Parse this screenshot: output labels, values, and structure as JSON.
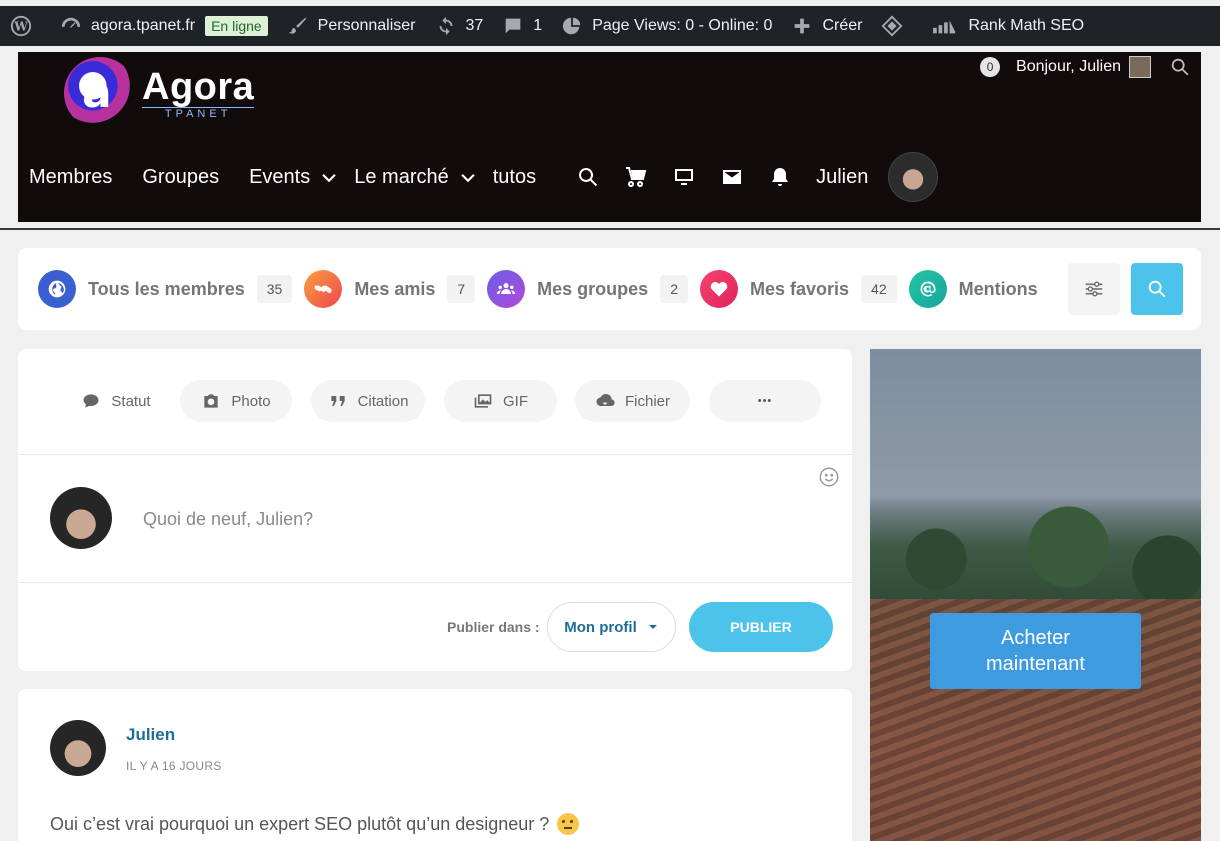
{
  "admin_bar": {
    "site_name": "agora.tpanet.fr",
    "status_badge": "En ligne",
    "customize": "Personnaliser",
    "updates_count": "37",
    "comments_count": "1",
    "page_views": "Page Views: 0 - Online: 0",
    "create": "Créer",
    "rank_math": "Rank Math SEO"
  },
  "header": {
    "logo_title": "Agora",
    "logo_subtitle": "TPANET",
    "notifications_count": "0",
    "greeting": "Bonjour, Julien",
    "nav": [
      "Membres",
      "Groupes",
      "Events",
      "Le marché",
      "tutos"
    ],
    "user_name": "Julien"
  },
  "filters": [
    {
      "label": "Tous les membres",
      "count": "35",
      "color": "#3a5fd0",
      "icon": "globe-icon"
    },
    {
      "label": "Mes amis",
      "count": "7",
      "color": "#f2674a",
      "icon": "handshake-icon"
    },
    {
      "label": "Mes groupes",
      "count": "2",
      "color": "#8e4ce0",
      "icon": "users-icon"
    },
    {
      "label": "Mes favoris",
      "count": "42",
      "color": "#ef3d6a",
      "icon": "heart-icon"
    },
    {
      "label": "Mentions",
      "count": "",
      "color": "#1fb8a0",
      "icon": "at-icon"
    }
  ],
  "composer": {
    "tabs": [
      "Statut",
      "Photo",
      "Citation",
      "GIF",
      "Fichier",
      "•••"
    ],
    "placeholder": "Quoi de neuf, Julien?",
    "publish_in_label": "Publier dans :",
    "publish_target": "Mon profil",
    "publish_button": "PUBLIER"
  },
  "post": {
    "author": "Julien",
    "time": "IL Y A 16 JOURS",
    "text": "Oui c’est vrai pourquoi un expert SEO plutôt qu’un designeur ?"
  },
  "ad": {
    "button_line1": "Acheter",
    "button_line2": "maintenant"
  },
  "colors": {
    "accent": "#4cc3ea",
    "link": "#1e6d99",
    "admin_bar": "#1d2327",
    "header_bg": "#120b0c"
  }
}
